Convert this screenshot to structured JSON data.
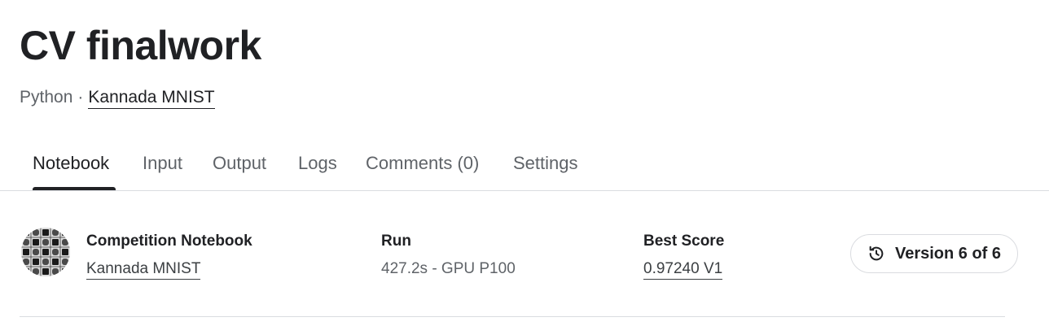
{
  "header": {
    "title": "CV finalwork",
    "language": "Python",
    "separator": "·",
    "dataset_link": "Kannada MNIST"
  },
  "tabs": [
    {
      "label": "Notebook",
      "active": true
    },
    {
      "label": "Input",
      "active": false
    },
    {
      "label": "Output",
      "active": false
    },
    {
      "label": "Logs",
      "active": false
    },
    {
      "label": "Comments (0)",
      "active": false
    },
    {
      "label": "Settings",
      "active": false
    }
  ],
  "info": {
    "competition": {
      "label": "Competition Notebook",
      "value": "Kannada MNIST"
    },
    "run": {
      "label": "Run",
      "value": "427.2s - GPU P100"
    },
    "best_score": {
      "label": "Best Score",
      "value": "0.97240 V1"
    },
    "version_button": {
      "label": "Version 6 of 6",
      "icon": "history-icon"
    }
  },
  "colors": {
    "text_primary": "#202124",
    "text_secondary": "#5f6368",
    "divider": "#dadce0"
  }
}
